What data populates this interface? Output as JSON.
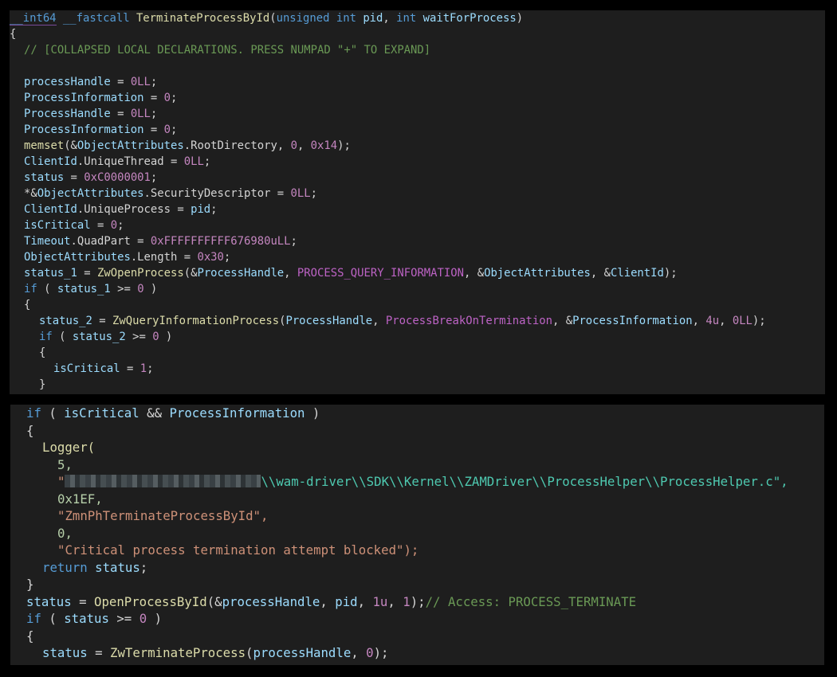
{
  "top": {
    "signature": {
      "ret_type": "__int64",
      "callconv": "__fastcall",
      "func_name": "TerminateProcessById",
      "open_paren": "(",
      "p1_type": "unsigned int",
      "p1_name": "pid",
      "comma": ", ",
      "p2_type": "int",
      "p2_name": "waitForProcess",
      "close_paren": ")"
    },
    "open_brace": "{",
    "collapsed_comment": "// [COLLAPSED LOCAL DECLARATIONS. PRESS NUMPAD \"+\" TO EXPAND]",
    "assignments": [
      {
        "lhs": "processHandle",
        "op": " = ",
        "val": "0LL",
        "end": ";"
      },
      {
        "lhs": "ProcessInformation",
        "op": " = ",
        "val": "0",
        "end": ";"
      },
      {
        "lhs": "ProcessHandle",
        "op": " = ",
        "val": "0LL",
        "end": ";"
      },
      {
        "lhs": "ProcessInformation",
        "op": " = ",
        "val": "0",
        "end": ";"
      }
    ],
    "memset_line": {
      "fn": "memset",
      "a": "(&",
      "b": "ObjectAttributes",
      "c": ".RootDirectory",
      "d": ", ",
      "e": "0",
      "f": ", ",
      "g": "0x14",
      "h": ");"
    },
    "clientid_thread": {
      "a": "ClientId",
      "b": ".UniqueThread = ",
      "c": "0LL",
      "d": ";"
    },
    "status_init": {
      "a": "status",
      "b": " = ",
      "c": "0xC0000001",
      "d": ";"
    },
    "secdesc": {
      "a": "*&",
      "b": "ObjectAttributes",
      "c": ".SecurityDescriptor = ",
      "d": "0LL",
      "e": ";"
    },
    "clientid_proc": {
      "a": "ClientId",
      "b": ".UniqueProcess = ",
      "c": "pid",
      "d": ";"
    },
    "iscritical_init": {
      "a": "isCritical",
      "b": " = ",
      "c": "0",
      "d": ";"
    },
    "timeout": {
      "a": "Timeout",
      "b": ".QuadPart = ",
      "c": "0xFFFFFFFFFF676980uLL",
      "d": ";"
    },
    "objlen": {
      "a": "ObjectAttributes",
      "b": ".Length = ",
      "c": "0x30",
      "d": ";"
    },
    "openproc": {
      "a": "status_1",
      "b": " = ",
      "c": "ZwOpenProcess",
      "d": "(&",
      "e": "ProcessHandle",
      "f": ", ",
      "g": "PROCESS_QUERY_INFORMATION",
      "h": ", &",
      "i": "ObjectAttributes",
      "j": ", &",
      "k": "ClientId",
      "l": ");"
    },
    "if1": {
      "kw": "if",
      "a": " ( ",
      "b": "status_1",
      "c": " >= ",
      "d": "0",
      "e": " )"
    },
    "brace1": "{",
    "query": {
      "a": "status_2",
      "b": " = ",
      "c": "ZwQueryInformationProcess",
      "d": "(",
      "e": "ProcessHandle",
      "f": ", ",
      "g": "ProcessBreakOnTermination",
      "h": ", &",
      "i": "ProcessInformation",
      "j": ", ",
      "k": "4u",
      "l": ", ",
      "m": "0LL",
      "n": ");"
    },
    "if2": {
      "kw": "if",
      "a": " ( ",
      "b": "status_2",
      "c": " >= ",
      "d": "0",
      "e": " )"
    },
    "brace2": "{",
    "setcrit": {
      "a": "isCritical",
      "b": " = ",
      "c": "1",
      "d": ";"
    },
    "brace3": "}"
  },
  "bottom": {
    "if3": {
      "kw": "if",
      "a": " ( ",
      "b": "isCritical",
      "c": " && ",
      "d": "ProcessInformation",
      "e": " )"
    },
    "brace4": "{",
    "logger": "Logger(",
    "arg1": "5,",
    "arg2_quote": "\"",
    "arg2_path": "\\\\wam-driver\\\\SDK\\\\Kernel\\\\ZAMDriver\\\\ProcessHelper\\\\ProcessHelper.c\",",
    "arg3": "0x1EF,",
    "arg4": "\"ZmnPhTerminateProcessById\",",
    "arg5": "0,",
    "arg6": "\"Critical process termination attempt blocked\");",
    "ret": {
      "kw": "return",
      "a": " ",
      "b": "status",
      "c": ";"
    },
    "brace5": "}",
    "openbyid": {
      "a": "status",
      "b": " = ",
      "c": "OpenProcessById",
      "d": "(&",
      "e": "processHandle",
      "f": ", ",
      "g": "pid",
      "h": ", ",
      "i": "1u",
      "j": ", ",
      "k": "1",
      "l": ");",
      "m": "// Access: PROCESS_TERMINATE"
    },
    "if4": {
      "kw": "if",
      "a": " ( ",
      "b": "status",
      "c": " >= ",
      "d": "0",
      "e": " )"
    },
    "brace6": "{",
    "terminate": {
      "a": "status",
      "b": " = ",
      "c": "ZwTerminateProcess",
      "d": "(",
      "e": "processHandle",
      "f": ", ",
      "g": "0",
      "h": ");"
    }
  }
}
